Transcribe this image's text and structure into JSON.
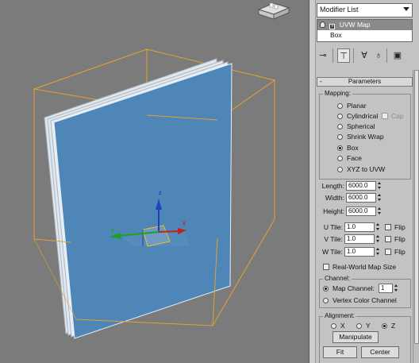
{
  "panel": {
    "modifier_list": "Modifier List",
    "stack": [
      {
        "label": "UVW Map",
        "selected": true
      },
      {
        "label": "Box",
        "selected": false
      }
    ],
    "toolbar_icons": [
      "pin-stack-icon",
      "show-end-result-icon",
      "make-unique-icon",
      "remove-modifier-icon",
      "configure-sets-icon"
    ],
    "rollout_minus": "-",
    "rollout_title": "Parameters",
    "mapping": {
      "title": "Mapping:",
      "options": [
        "Planar",
        "Cylindrical",
        "Spherical",
        "Shrink Wrap",
        "Box",
        "Face",
        "XYZ to UVW"
      ],
      "selected": "Box",
      "cap_label": "Cap"
    },
    "dimensions": {
      "length_label": "Length:",
      "length_value": "6000.0",
      "width_label": "Width:",
      "width_value": "6000.0",
      "height_label": "Height:",
      "height_value": "6000.0"
    },
    "tiles": {
      "u_label": "U Tile:",
      "u_value": "1.0",
      "v_label": "V Tile:",
      "v_value": "1.0",
      "w_label": "W Tile:",
      "w_value": "1.0",
      "flip_label": "Flip"
    },
    "real_world_label": "Real-World Map Size",
    "channel": {
      "title": "Channel:",
      "map_channel_label": "Map Channel:",
      "map_channel_value": "1",
      "vertex_color_label": "Vertex Color Channel",
      "selected": "Map Channel"
    },
    "alignment": {
      "title": "Alignment:",
      "x": "X",
      "y": "Y",
      "z": "Z",
      "selected": "Z",
      "manipulate": "Manipulate",
      "fit": "Fit",
      "center": "Center"
    }
  },
  "viewport": {
    "axis_x": "x",
    "axis_y": "y",
    "axis_z": "z",
    "colors": {
      "background": "#7b7b7b",
      "bounding_box": "#e8a030",
      "plane_fill": "#4f86b8",
      "axis_x": "#c02020",
      "axis_y": "#20a020",
      "axis_z": "#2040c0"
    }
  }
}
